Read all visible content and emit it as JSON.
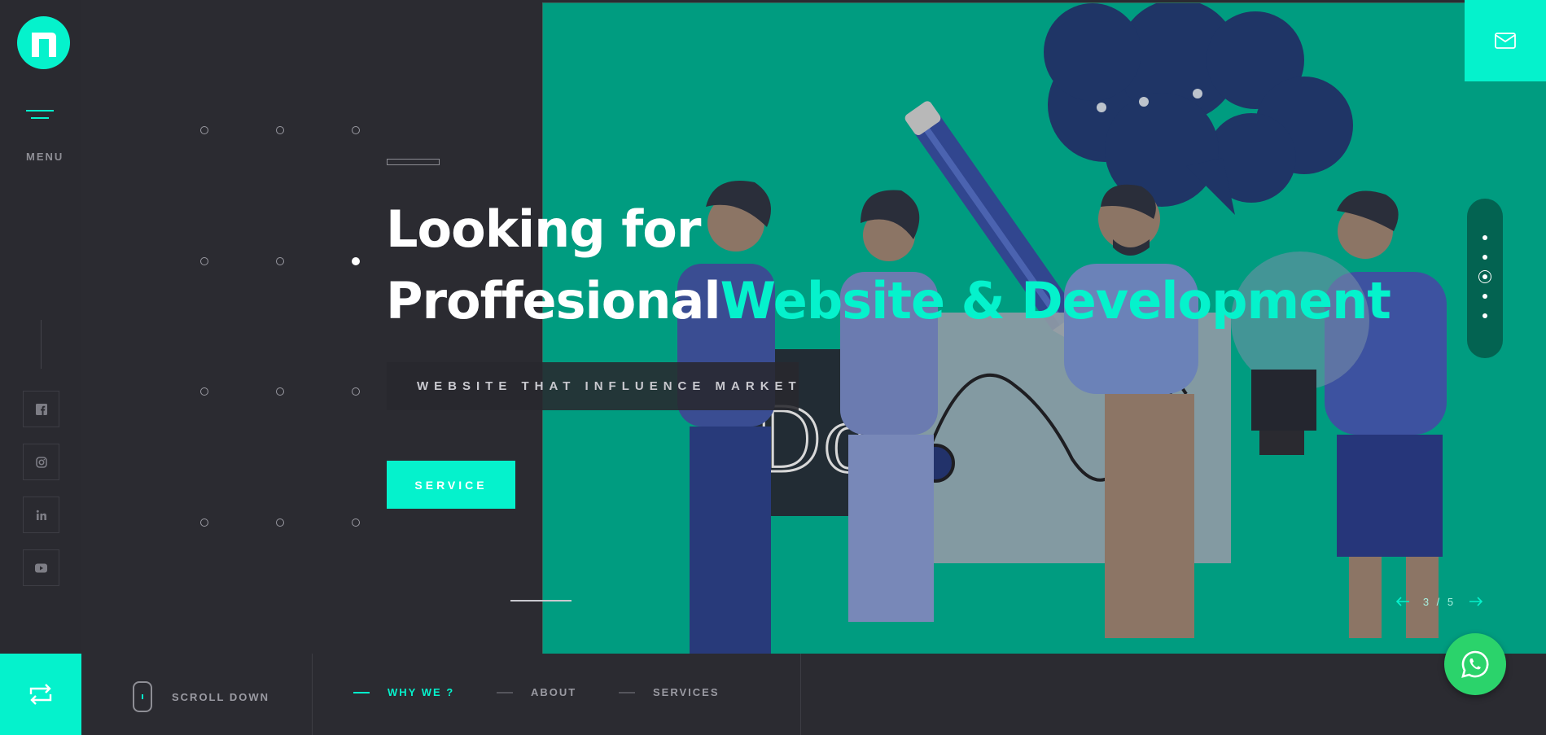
{
  "menu": {
    "label": "MENU"
  },
  "hero": {
    "headline_line1": "Looking for",
    "headline_line2_main": "Proffesional",
    "headline_line2_accent": "Website & Development",
    "tagline": "WEBSITE THAT INFLUENCE MARKET",
    "cta_label": "SERVICE"
  },
  "slider": {
    "counter": "3 / 5",
    "current": 3,
    "total": 5
  },
  "bottom": {
    "scroll_label": "SCROLL DOWN",
    "nav": [
      {
        "label": "WHY WE ?",
        "active": true
      },
      {
        "label": "ABOUT",
        "active": false
      },
      {
        "label": "SERVICES",
        "active": false
      }
    ]
  },
  "social": [
    "facebook-icon",
    "instagram-icon",
    "linkedin-icon",
    "youtube-icon"
  ],
  "colors": {
    "accent": "#05f2cc",
    "background": "#2b2b31",
    "hero": "#009c80",
    "whatsapp": "#2bd36b"
  }
}
